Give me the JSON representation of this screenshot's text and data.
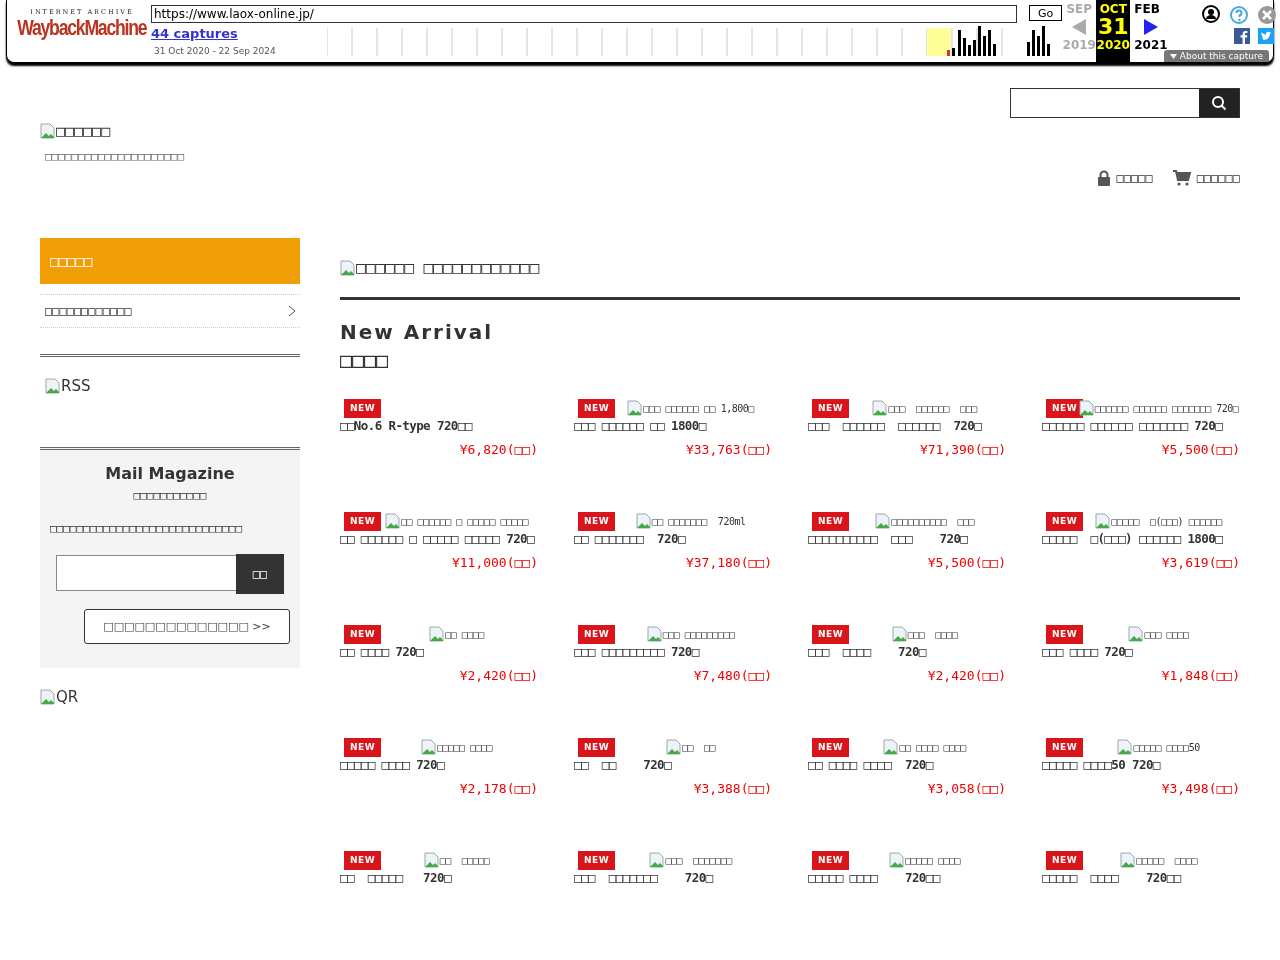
{
  "wayback": {
    "logo_top": "INTERNET ARCHIVE",
    "logo": "WaybackMachine",
    "url": "https://www.laox-online.jp/",
    "go": "Go",
    "captures": "44 captures",
    "range": "31 Oct 2020 - 22 Sep 2024",
    "calendar": [
      {
        "month": "SEP",
        "year": "2019",
        "selected": false
      },
      {
        "month": "OCT",
        "day": "31",
        "year": "2020",
        "selected": true
      },
      {
        "month": "FEB",
        "year": "2021",
        "selected": false
      }
    ],
    "about": "About this capture"
  },
  "header": {
    "logo_alt": "□□□□□□",
    "tagline": "□□□□□□□□□□□□□□□□□□□□□",
    "links": [
      {
        "kind": "login",
        "label": "□□□□□"
      },
      {
        "kind": "cart",
        "label": "□□□□□□"
      }
    ]
  },
  "sidebar": {
    "category_title": "□□□□□",
    "items": [
      {
        "label": "□□□□□□□□□□□□"
      }
    ],
    "rss_alt": "RSS",
    "mail": {
      "title": "Mail Magazine",
      "subtitle": "□□□□□□□□□□□",
      "text": "□□□□□□□□□□□□□□□□□□□□□□□□□□□□□",
      "button": "□□",
      "link": "□□□□□□□□□□□□□□ >>"
    },
    "qr_alt": "QR"
  },
  "main": {
    "banner_alt": "□□□□□□ □□□□□□□□□□□□",
    "heading": "New Arrival",
    "subheading": "□□□□",
    "products": [
      {
        "name": "□□No.6 R-type 720□□",
        "price": "¥6,820(□□)",
        "badge": "NEW"
      },
      {
        "alt": "□□□ □□□□□□ □□ 1,800□",
        "name": "□□□ □□□□□□ □□ 1800□",
        "price": "¥33,763(□□)",
        "badge": "NEW"
      },
      {
        "alt": "□□□  □□□□□□  □□□",
        "name": "□□□  □□□□□□  □□□□□□  720□",
        "price": "¥71,390(□□)",
        "badge": "NEW"
      },
      {
        "alt": "□□□□□□ □□□□□□ □□□□□□□ 720□",
        "name": "□□□□□□ □□□□□□ □□□□□□□ 720□",
        "price": "¥5,500(□□)",
        "badge": "NEW"
      },
      {
        "alt": "□□ □□□□□□ □ □□□□□ □□□□□",
        "name": "□□ □□□□□□ □ □□□□□ □□□□□ 720□",
        "price": "¥11,000(□□)",
        "badge": "NEW"
      },
      {
        "alt": "□□ □□□□□□□  720ml",
        "name": "□□ □□□□□□□  720□",
        "price": "¥37,180(□□)",
        "badge": "NEW"
      },
      {
        "alt": "□□□□□□□□□□  □□□",
        "name": "□□□□□□□□□□  □□□    720□",
        "price": "¥5,500(□□)",
        "badge": "NEW"
      },
      {
        "alt": "□□□□□  □(□□□) □□□□□□",
        "name": "□□□□□  □(□□□) □□□□□□ 1800□",
        "price": "¥3,619(□□)",
        "badge": "NEW"
      },
      {
        "alt": "□□ □□□□",
        "name": "□□ □□□□ 720□",
        "price": "¥2,420(□□)",
        "badge": "NEW"
      },
      {
        "alt": "□□□ □□□□□□□□□",
        "name": "□□□ □□□□□□□□□ 720□",
        "price": "¥7,480(□□)",
        "badge": "NEW"
      },
      {
        "alt": "□□□  □□□□",
        "name": "□□□  □□□□    720□",
        "price": "¥2,420(□□)",
        "badge": "NEW"
      },
      {
        "alt": "□□□ □□□□",
        "name": "□□□ □□□□ 720□",
        "price": "¥1,848(□□)",
        "badge": "NEW"
      },
      {
        "alt": "□□□□□ □□□□",
        "name": "□□□□□ □□□□ 720□",
        "price": "¥2,178(□□)",
        "badge": "NEW"
      },
      {
        "alt": "□□  □□",
        "name": "□□  □□    720□",
        "price": "¥3,388(□□)",
        "badge": "NEW"
      },
      {
        "alt": "□□ □□□□ □□□□",
        "name": "□□ □□□□ □□□□  720□",
        "price": "¥3,058(□□)",
        "badge": "NEW"
      },
      {
        "alt": "□□□□□ □□□□50",
        "name": "□□□□□ □□□□50 720□",
        "price": "¥3,498(□□)",
        "badge": "NEW"
      },
      {
        "alt": "□□  □□□□□",
        "name": "□□  □□□□□   720□",
        "badge": "NEW"
      },
      {
        "alt": "□□□  □□□□□□□",
        "name": "□□□  □□□□□□□    720□",
        "badge": "NEW"
      },
      {
        "alt": "□□□□□ □□□□",
        "name": "□□□□□ □□□□    720□□",
        "badge": "NEW"
      },
      {
        "alt": "□□□□□  □□□□",
        "name": "□□□□□  □□□□    720□□",
        "badge": "NEW"
      }
    ]
  }
}
